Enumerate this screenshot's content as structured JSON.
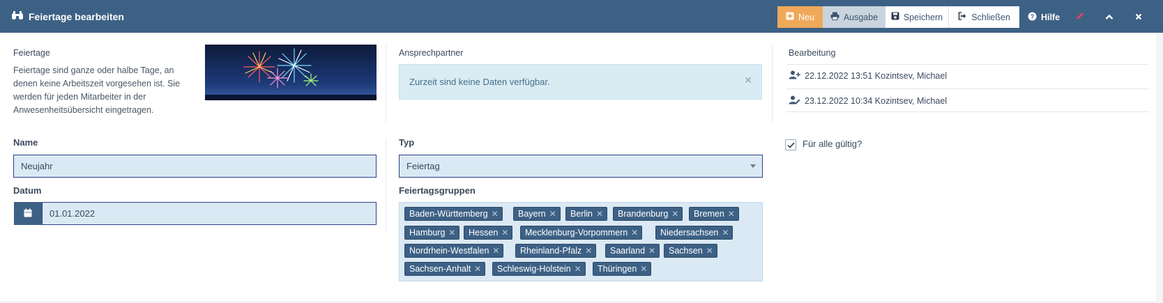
{
  "header": {
    "title": "Feiertage bearbeiten",
    "buttons": {
      "neu": "Neu",
      "ausgabe": "Ausgabe",
      "speichern": "Speichern",
      "schliessen": "Schließen",
      "hilfe": "Hilfe"
    }
  },
  "info": {
    "title": "Feiertage",
    "description": "Feiertage sind ganze oder halbe Tage, an denen keine Arbeitszeit vorgesehen ist. Sie werden für jeden Mitarbeiter in der Anwesenheitsübersicht eingetragen."
  },
  "contacts": {
    "title": "Ansprechpartner",
    "empty_message": "Zurzeit sind keine Daten verfügbar."
  },
  "editing": {
    "title": "Bearbeitung",
    "entries": [
      {
        "text": "22.12.2022 13:51 Kozintsev, Michael"
      },
      {
        "text": "23.12.2022 10:34 Kozintsev, Michael"
      }
    ]
  },
  "form": {
    "name_label": "Name",
    "name_value": "Neujahr",
    "datum_label": "Datum",
    "datum_value": "01.01.2022",
    "typ_label": "Typ",
    "typ_value": "Feiertag",
    "gruppen_label": "Feiertagsgruppen",
    "gruppen": [
      "Baden-Württemberg",
      "Bayern",
      "Berlin",
      "Brandenburg",
      "Bremen",
      "Hamburg",
      "Hessen",
      "Mecklenburg-Vorpommern",
      "Niedersachsen",
      "Nordrhein-Westfalen",
      "Rheinland-Pfalz",
      "Saarland",
      "Sachsen",
      "Sachsen-Anhalt",
      "Schleswig-Holstein",
      "Thüringen"
    ],
    "alle_label": "Für alle gültig?",
    "alle_checked": true
  },
  "colors": {
    "header": "#3d6185",
    "accent_orange": "#f0a85a",
    "field_bg": "#dbe9f4",
    "tag_bg": "#3d6185"
  }
}
